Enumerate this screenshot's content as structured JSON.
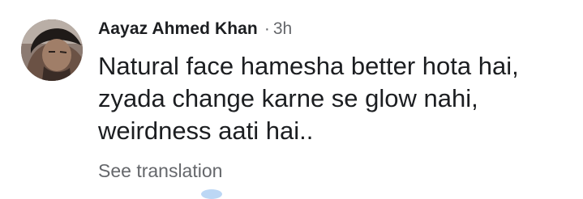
{
  "comment": {
    "author": "Aayaz Ahmed Khan",
    "separator": "·",
    "time": "3h",
    "text_lines": [
      "Natural face hamesha better hota hai,",
      "zyada change karne se glow nahi,",
      "weirdness aati hai.."
    ],
    "translate_label": "See translation"
  },
  "colors": {
    "text_primary": "#1c1e21",
    "text_secondary": "#65676b"
  }
}
